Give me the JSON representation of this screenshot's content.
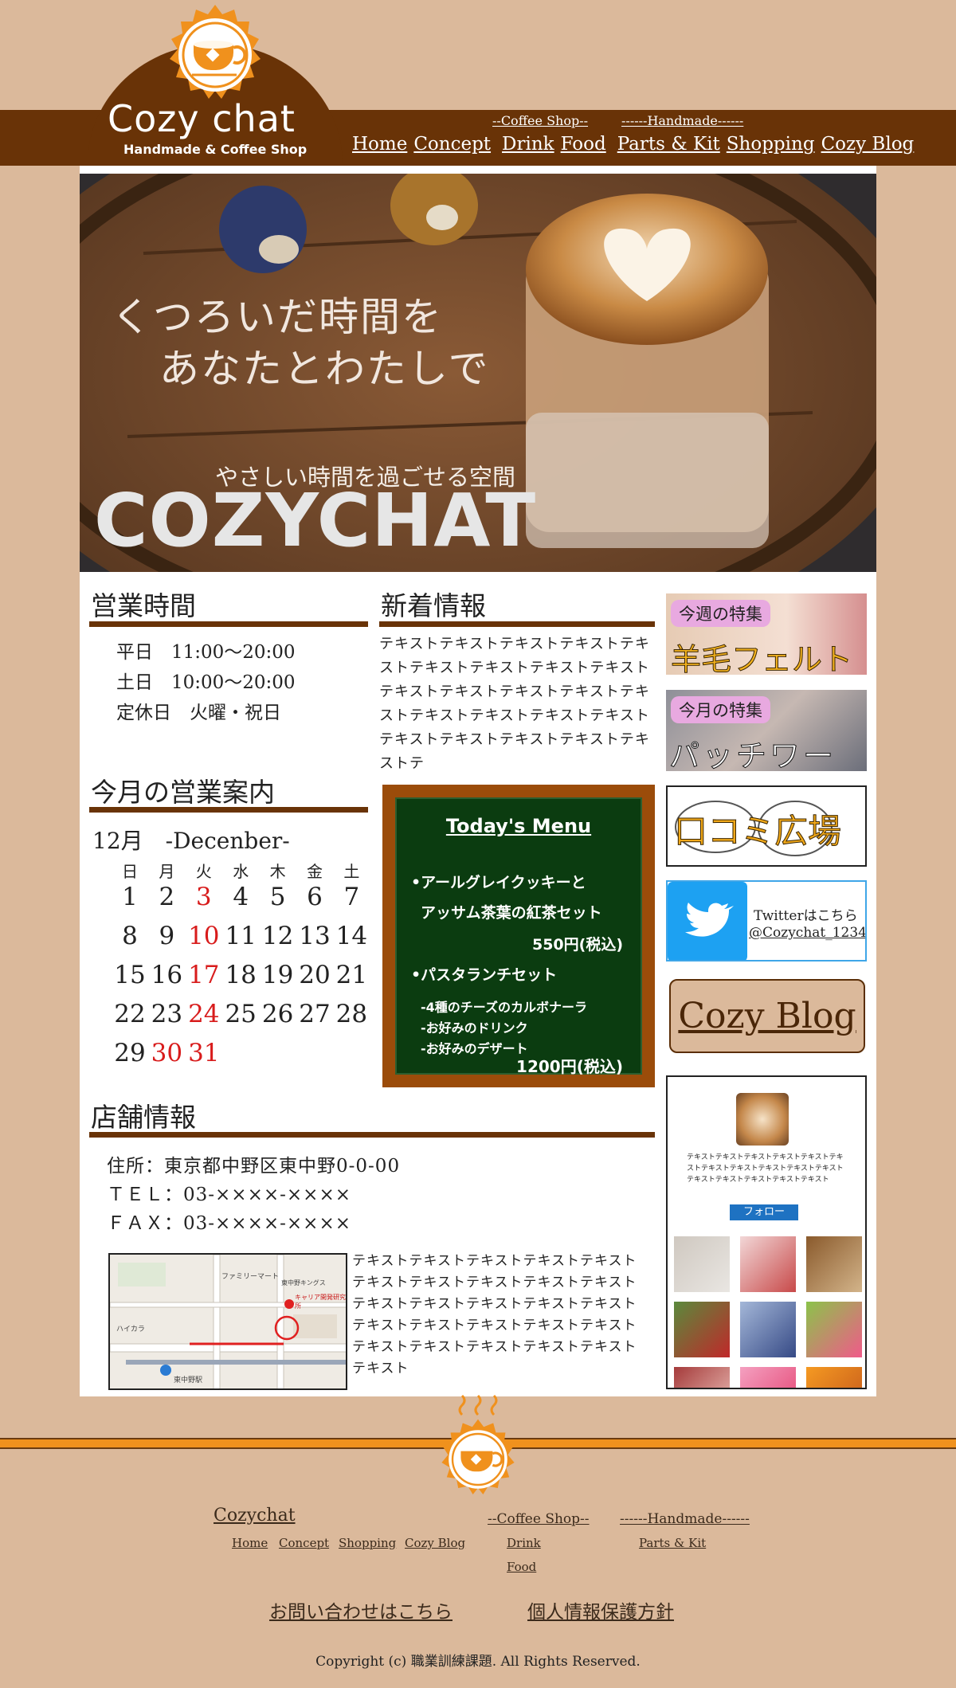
{
  "header": {
    "logo_title": "Cozy chat",
    "logo_sub": "Handmade & Coffee Shop",
    "sup_coffee": "--Coffee Shop--",
    "sup_handmade": "------Handmade------",
    "nav": [
      "Home",
      "Concept",
      "Drink",
      "Food",
      "Parts & Kit",
      "Shopping",
      "Cozy Blog"
    ]
  },
  "hero": {
    "line1": "くつろいだ時間を",
    "line2": "あなたとわたしで",
    "tagline": "やさしい時間を過ごせる空間",
    "brand": "COZYCHAT"
  },
  "hours": {
    "title": "営業時間",
    "rows": [
      "平日　11:00〜20:00",
      "土日　10:00〜20:00",
      "定休日　火曜・祝日"
    ]
  },
  "news": {
    "title": "新着情報",
    "text": "テキストテキストテキストテキストテキストテキストテキストテキストテキストテキストテキストテキストテキストテキストテキストテキストテキストテキストテキストテキストテキストテキストテキストテ"
  },
  "calendar": {
    "title": "今月の営業案内",
    "month": "12月　-Decenber-",
    "weekdays": [
      "日",
      "月",
      "火",
      "水",
      "木",
      "金",
      "土"
    ],
    "days": [
      "1",
      "2",
      "3",
      "4",
      "5",
      "6",
      "7",
      "8",
      "9",
      "10",
      "11",
      "12",
      "13",
      "14",
      "15",
      "16",
      "17",
      "18",
      "19",
      "20",
      "21",
      "22",
      "23",
      "24",
      "25",
      "26",
      "27",
      "28",
      "29",
      "30",
      "31"
    ],
    "closed": [
      "3",
      "10",
      "17",
      "24",
      "30",
      "31"
    ]
  },
  "menu": {
    "title": "Today's Menu",
    "item1a": "•アールグレイクッキーと",
    "item1b": "アッサム茶葉の紅茶セット",
    "price1": "550円(税込)",
    "item2": "•パスタランチセット",
    "sub1": "-4種のチーズのカルボナーラ",
    "sub2": "-お好みのドリンク",
    "sub3": "-お好みのデザート",
    "price2": "1200円(税込)"
  },
  "shop": {
    "title": "店舗情報",
    "address": "住所：東京都中野区東中野0-0-00",
    "tel": "ＴＥＬ：03-××××-××××",
    "fax": "ＦＡＸ：03-××××-××××",
    "text": "テキストテキストテキストテキストテキストテキストテキストテキストテキストテキストテキストテキストテキストテキストテキストテキストテキストテキストテキストテキストテキストテキストテキストテキストテキストテキスト"
  },
  "map": {
    "labels": [
      "東中野駅",
      "ファミリーマート",
      "ハイカラ",
      "東中野キングス",
      "キャリア開発研究所"
    ]
  },
  "sidebar": {
    "b1_tag": "今週の特集",
    "b1_text": "羊毛フェルト",
    "b2_tag": "今月の特集",
    "b2_text": "パッチワーク",
    "b3_text": "口コミ広場",
    "twitter_line1": "Twitterはこちら",
    "twitter_line2": "@Cozychat_1234",
    "blog_button": "Cozy Blog",
    "insta_text": "テキストテキストテキストテキストテキストテキストテキストテキストテキストテキストテキストテキストテキストテキストテキストテキスト",
    "follow": "フォロー"
  },
  "footer": {
    "brand": "Cozychat",
    "links": [
      "Home",
      "Concept",
      "Shopping",
      "Cozy Blog"
    ],
    "coffee_head": "--Coffee Shop--",
    "coffee_links": [
      "Drink",
      "Food"
    ],
    "hand_head": "------Handmade------",
    "hand_links": [
      "Parts & Kit"
    ],
    "contact": "お問い合わせはこちら",
    "privacy": "個人情報保護方針",
    "copyright": "Copyright (c) 職業訓練課題. All Rights Reserved."
  },
  "colors": {
    "brown": "#693307",
    "beige": "#dbb99b",
    "orange": "#f0911d",
    "red": "#d81c1c",
    "chalk": "#0b3c10"
  }
}
